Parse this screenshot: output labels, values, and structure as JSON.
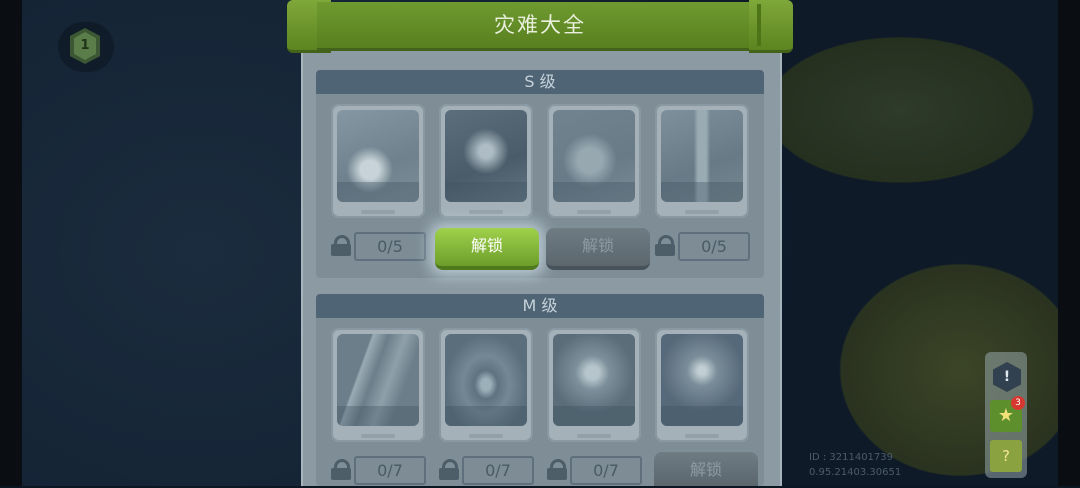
{
  "title": "灾难大全",
  "player_level": "1",
  "sections": [
    {
      "name": "S 级",
      "cards": [
        {
          "art": "card-art-hand",
          "count": "0/5",
          "state": "locked"
        },
        {
          "art": "card-art-storm",
          "unlock_label": "解锁",
          "state": "unlockable"
        },
        {
          "art": "card-art-creature",
          "unlock_label": "解锁",
          "state": "unlock-disabled"
        },
        {
          "art": "card-art-tornado",
          "count": "0/5",
          "state": "locked"
        }
      ]
    },
    {
      "name": "M 级",
      "cards": [
        {
          "art": "card-art-ruins",
          "count": "0/7",
          "state": "locked"
        },
        {
          "art": "card-art-whirlpool",
          "count": "0/7",
          "state": "locked"
        },
        {
          "art": "card-art-explosion",
          "count": "0/7",
          "state": "locked"
        },
        {
          "art": "card-art-cosmic",
          "unlock_label": "解锁",
          "state": "unlock-disabled"
        }
      ]
    }
  ],
  "dock": {
    "info_label": "!",
    "badge_count": "3"
  },
  "debug": {
    "id_line": "ID : 3211401739",
    "coords_line": "0.95.21403.30651"
  },
  "colors": {
    "accent_green": "#6d9e2a",
    "panel": "#8c9aa3",
    "section_header": "#4f6474"
  }
}
